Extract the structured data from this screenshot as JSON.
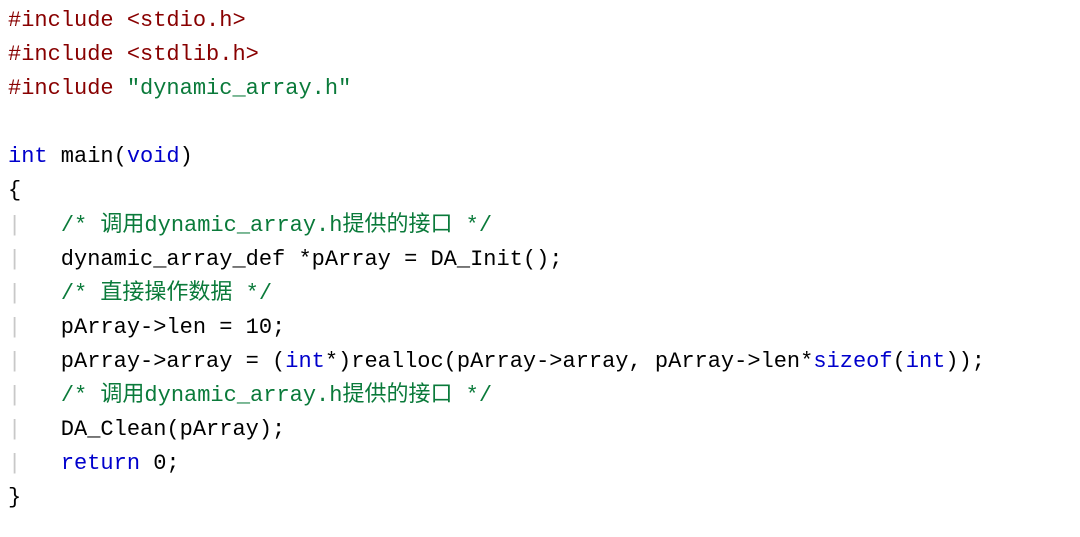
{
  "code": {
    "lines": [
      {
        "segments": [
          {
            "cls": "pp",
            "text": "#include"
          },
          {
            "cls": "plain",
            "text": " "
          },
          {
            "cls": "ang",
            "text": "<stdio.h>"
          }
        ]
      },
      {
        "segments": [
          {
            "cls": "pp",
            "text": "#include"
          },
          {
            "cls": "plain",
            "text": " "
          },
          {
            "cls": "ang",
            "text": "<stdlib.h>"
          }
        ]
      },
      {
        "segments": [
          {
            "cls": "pp",
            "text": "#include"
          },
          {
            "cls": "plain",
            "text": " "
          },
          {
            "cls": "str",
            "text": "\"dynamic_array.h\""
          }
        ]
      },
      {
        "segments": []
      },
      {
        "segments": [
          {
            "cls": "kw",
            "text": "int"
          },
          {
            "cls": "plain",
            "text": " main("
          },
          {
            "cls": "kw",
            "text": "void"
          },
          {
            "cls": "plain",
            "text": ")"
          }
        ]
      },
      {
        "segments": [
          {
            "cls": "plain",
            "text": "{"
          }
        ]
      },
      {
        "segments": [
          {
            "cls": "guide",
            "text": "|"
          },
          {
            "cls": "plain",
            "text": "   "
          },
          {
            "cls": "cmt",
            "text": "/* 调用dynamic_array.h提供的接口 */"
          }
        ]
      },
      {
        "segments": [
          {
            "cls": "guide",
            "text": "|"
          },
          {
            "cls": "plain",
            "text": "   dynamic_array_def *pArray = DA_Init();"
          }
        ]
      },
      {
        "segments": [
          {
            "cls": "guide",
            "text": "|"
          },
          {
            "cls": "plain",
            "text": "   "
          },
          {
            "cls": "cmt",
            "text": "/* 直接操作数据 */"
          }
        ]
      },
      {
        "segments": [
          {
            "cls": "guide",
            "text": "|"
          },
          {
            "cls": "plain",
            "text": "   pArray->len = 10;"
          }
        ]
      },
      {
        "segments": [
          {
            "cls": "guide",
            "text": "|"
          },
          {
            "cls": "plain",
            "text": "   pArray->array = ("
          },
          {
            "cls": "kw",
            "text": "int"
          },
          {
            "cls": "plain",
            "text": "*)realloc(pArray->array, pArray->len*"
          },
          {
            "cls": "kw",
            "text": "sizeof"
          },
          {
            "cls": "plain",
            "text": "("
          },
          {
            "cls": "kw",
            "text": "int"
          },
          {
            "cls": "plain",
            "text": "));"
          }
        ]
      },
      {
        "segments": [
          {
            "cls": "guide",
            "text": "|"
          },
          {
            "cls": "plain",
            "text": "   "
          },
          {
            "cls": "cmt",
            "text": "/* 调用dynamic_array.h提供的接口 */"
          }
        ]
      },
      {
        "segments": [
          {
            "cls": "guide",
            "text": "|"
          },
          {
            "cls": "plain",
            "text": "   DA_Clean(pArray);"
          }
        ]
      },
      {
        "segments": [
          {
            "cls": "guide",
            "text": "|"
          },
          {
            "cls": "plain",
            "text": "   "
          },
          {
            "cls": "kw",
            "text": "return"
          },
          {
            "cls": "plain",
            "text": " 0;"
          }
        ]
      },
      {
        "segments": [
          {
            "cls": "plain",
            "text": "}"
          }
        ]
      }
    ]
  }
}
